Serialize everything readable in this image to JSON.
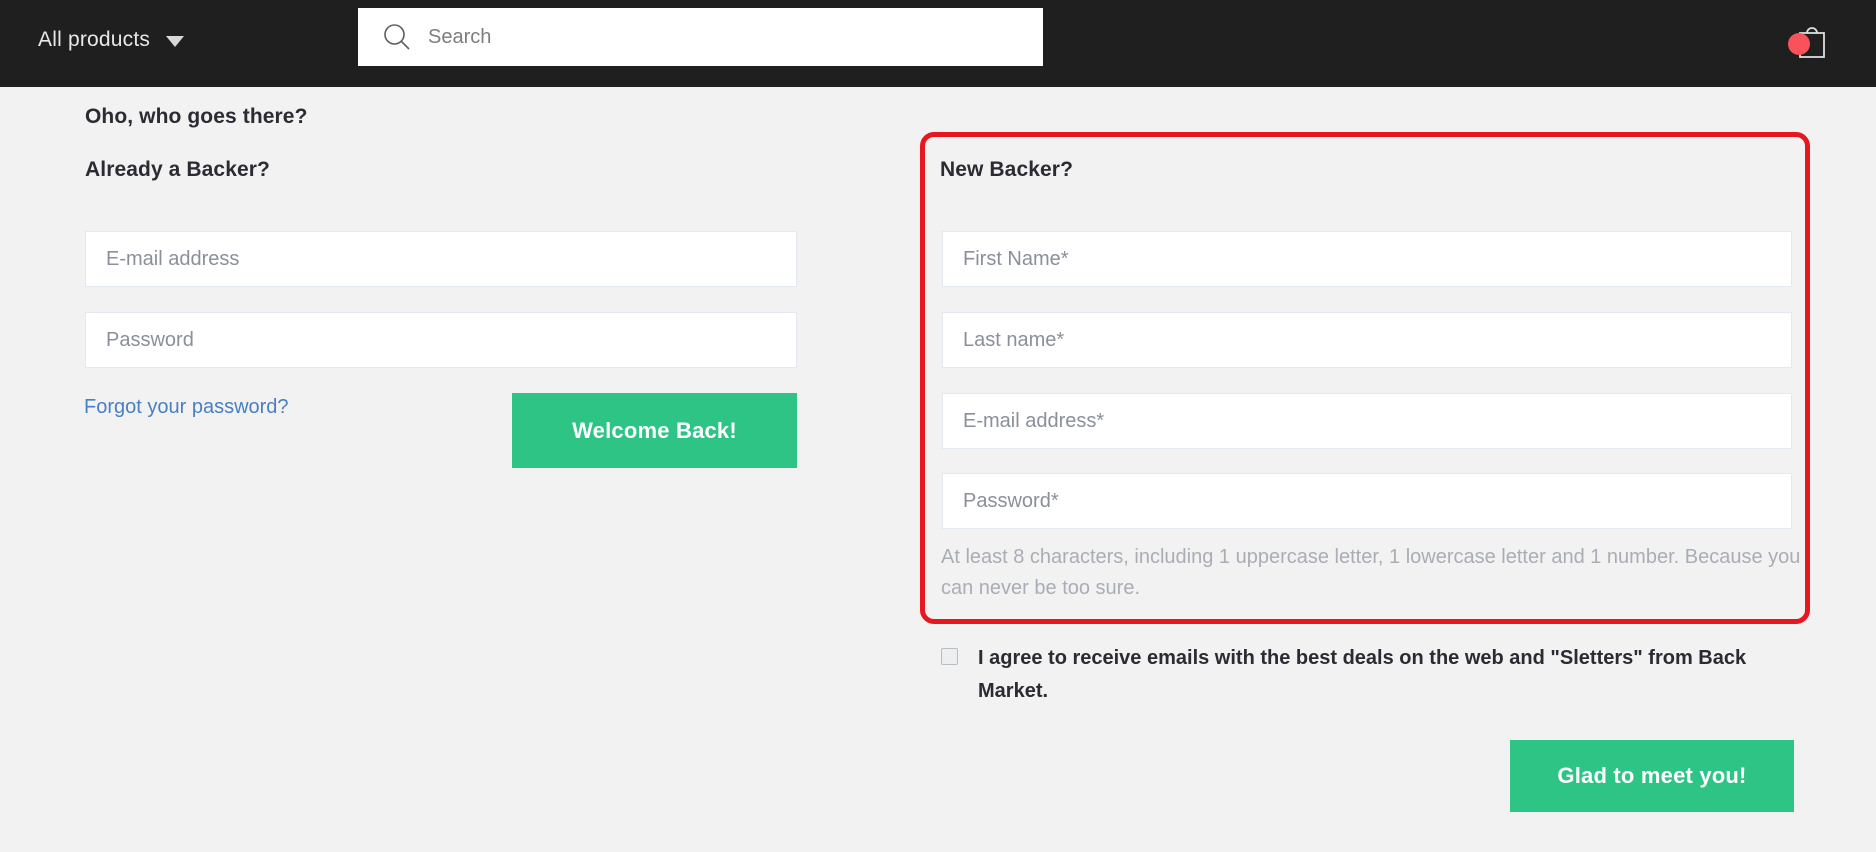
{
  "header": {
    "all_products_label": "All products",
    "caret_icon": "chevron-down-icon",
    "search": {
      "placeholder": "Search",
      "value": "",
      "icon": "search-icon"
    },
    "cart": {
      "icon": "shopping-bag-icon",
      "badge_visible": true,
      "badge_color": "#f9525a"
    },
    "background_color": "#1f1f1f"
  },
  "login": {
    "title": "Oho, who goes there?",
    "subtitle": "Already a Backer?",
    "email": {
      "placeholder": "E-mail address",
      "value": ""
    },
    "password": {
      "placeholder": "Password",
      "value": ""
    },
    "forgot_link": "Forgot your password?",
    "forgot_link_color": "#4a7fc1",
    "submit_label": "Welcome Back!"
  },
  "signup": {
    "title": "New Backer?",
    "first_name": {
      "placeholder": "First Name*",
      "value": ""
    },
    "last_name": {
      "placeholder": "Last name*",
      "value": ""
    },
    "email": {
      "placeholder": "E-mail address*",
      "value": ""
    },
    "password": {
      "placeholder": "Password*",
      "value": ""
    },
    "password_hint": "At least 8 characters, including 1 uppercase letter, 1 lowercase letter and 1 number. Because you can never be too sure.",
    "consent_label": "I agree to receive emails with the best deals on the web and \"Sletters\" from Back Market.",
    "consent_checked": false,
    "submit_label": "Glad to meet you!"
  },
  "annotation": {
    "color": "#e8161f",
    "shape": "rounded-rectangle-highlight"
  },
  "theme": {
    "page_background": "#f2f2f2",
    "accent_green": "#2ec486",
    "text_dark": "#2b2b33",
    "placeholder_gray": "#8a8f9a"
  }
}
